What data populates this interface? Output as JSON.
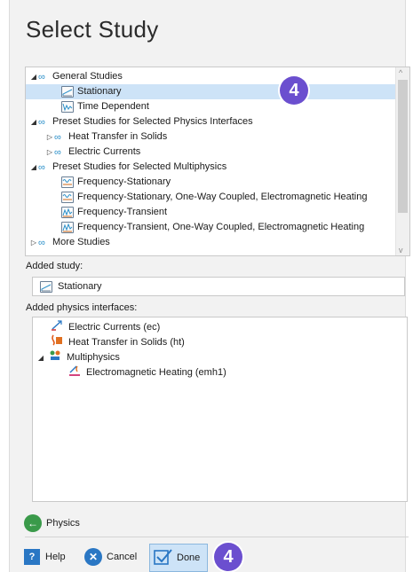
{
  "title": "Select Study",
  "tree": [
    {
      "label": "General Studies",
      "indent": 0,
      "twisty": "◢",
      "icon": "study-group",
      "selected": false
    },
    {
      "label": "Stationary",
      "indent": 2,
      "twisty": "",
      "icon": "stationary",
      "selected": true
    },
    {
      "label": "Time Dependent",
      "indent": 2,
      "twisty": "",
      "icon": "time-dependent",
      "selected": false
    },
    {
      "label": "Preset Studies for Selected Physics Interfaces",
      "indent": 0,
      "twisty": "◢",
      "icon": "study-group",
      "selected": false
    },
    {
      "label": "Heat Transfer in Solids",
      "indent": 1,
      "twisty": "▷",
      "icon": "study-group",
      "selected": false
    },
    {
      "label": "Electric Currents",
      "indent": 1,
      "twisty": "▷",
      "icon": "study-group",
      "selected": false
    },
    {
      "label": "Preset Studies for Selected Multiphysics",
      "indent": 0,
      "twisty": "◢",
      "icon": "study-group",
      "selected": false
    },
    {
      "label": "Frequency-Stationary",
      "indent": 2,
      "twisty": "",
      "icon": "frequency-stationary",
      "selected": false
    },
    {
      "label": "Frequency-Stationary, One-Way Coupled, Electromagnetic Heating",
      "indent": 2,
      "twisty": "",
      "icon": "frequency-stationary",
      "selected": false
    },
    {
      "label": "Frequency-Transient",
      "indent": 2,
      "twisty": "",
      "icon": "frequency-transient",
      "selected": false
    },
    {
      "label": "Frequency-Transient, One-Way Coupled, Electromagnetic Heating",
      "indent": 2,
      "twisty": "",
      "icon": "frequency-transient",
      "selected": false
    },
    {
      "label": "More Studies",
      "indent": 0,
      "twisty": "▷",
      "icon": "study-group",
      "selected": false
    }
  ],
  "added_study": {
    "label": "Added study:",
    "value": "Stationary"
  },
  "added_physics": {
    "label": "Added physics interfaces:",
    "items": [
      {
        "label": "Electric Currents (ec)",
        "indent": 0,
        "twisty": ""
      },
      {
        "label": "Heat Transfer in Solids (ht)",
        "indent": 0,
        "twisty": ""
      },
      {
        "label": "Multiphysics",
        "indent": 0,
        "twisty": "◢"
      },
      {
        "label": "Electromagnetic Heating (emh1)",
        "indent": 1,
        "twisty": ""
      }
    ]
  },
  "badges": [
    "4",
    "4"
  ],
  "footer": {
    "physics": "Physics",
    "help": "Help",
    "cancel": "Cancel",
    "done": "Done"
  },
  "colors": {
    "accent": "#6b4fcf",
    "selection": "#cde3f7",
    "physics_button": "#3a9a4a",
    "cancel_button": "#2a77c4",
    "help_button": "#2a77c4"
  }
}
